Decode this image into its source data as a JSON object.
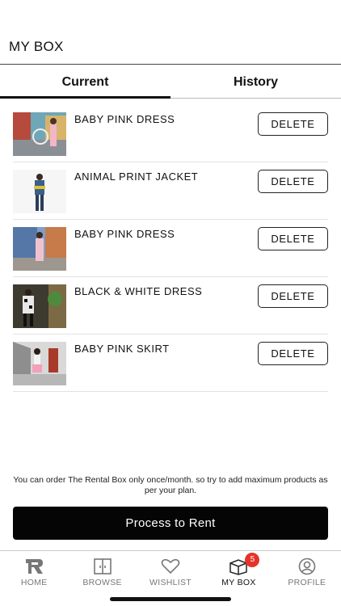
{
  "header": {
    "title": "MY BOX"
  },
  "tabs": [
    {
      "label": "Current",
      "active": true
    },
    {
      "label": "History",
      "active": false
    }
  ],
  "items": [
    {
      "name": "BABY PINK DRESS",
      "delete_label": "DELETE"
    },
    {
      "name": "ANIMAL PRINT JACKET",
      "delete_label": "DELETE"
    },
    {
      "name": "BABY PINK DRESS",
      "delete_label": "DELETE"
    },
    {
      "name": "BLACK & WHITE DRESS",
      "delete_label": "DELETE"
    },
    {
      "name": "BABY PINK SKIRT",
      "delete_label": "DELETE"
    }
  ],
  "note": "You can order The Rental Box only once/month. so try to add maximum products as per your plan.",
  "cta": {
    "label": "Process to Rent"
  },
  "tabbar": {
    "items": [
      {
        "label": "HOME",
        "icon": "logo-icon"
      },
      {
        "label": "BROWSE",
        "icon": "browse-icon"
      },
      {
        "label": "WISHLIST",
        "icon": "heart-icon"
      },
      {
        "label": "MY BOX",
        "icon": "box-icon",
        "badge": "5",
        "active": true
      },
      {
        "label": "PROFILE",
        "icon": "user-icon"
      }
    ]
  },
  "colors": {
    "accent": "#050505",
    "badge": "#e5332a"
  }
}
